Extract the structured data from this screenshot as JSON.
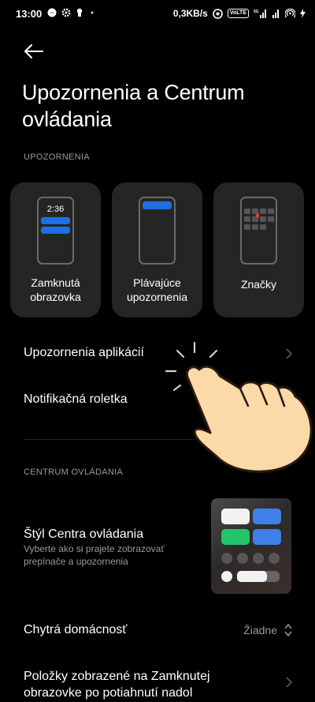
{
  "status_bar": {
    "time": "13:00",
    "speed": "0,3KB/s",
    "vo_label": "VoLTE",
    "net_label": "5G"
  },
  "header": {
    "title": "Upozornenia a Centrum ovládania"
  },
  "notifications_section": {
    "label": "UPOZORNENIA",
    "cards": [
      {
        "label": "Zamknutá obrazovka",
        "clock": "2:36",
        "icon": "lock-screen-preview-icon"
      },
      {
        "label": "Plávajúce upozornenia",
        "icon": "floating-notification-preview-icon"
      },
      {
        "label": "Značky",
        "icon": "app-badges-preview-icon"
      }
    ],
    "rows": [
      {
        "title": "Upozornenia aplikácií",
        "has_chevron": true
      },
      {
        "title": "Notifikačná roletka",
        "has_chevron": false
      }
    ]
  },
  "control_center_section": {
    "label": "CENTRUM OVLÁDANIA",
    "style_row": {
      "title": "Štýl Centra ovládania",
      "subtitle": "Vyberte ako si prajete zobrazovať prepínače a upozornenia"
    },
    "smart_home_row": {
      "title": "Chytrá domácnosť",
      "value": "Žiadne"
    },
    "lockscreen_items_row": {
      "title": "Položky zobrazené na Zamknutej obrazovke po potiahnutí nadol"
    }
  },
  "colors": {
    "background": "#000000",
    "card": "#252525",
    "accent_blue": "#1e6fe0",
    "secondary_text": "#9a9a9a",
    "green_tile": "#25c46b"
  }
}
